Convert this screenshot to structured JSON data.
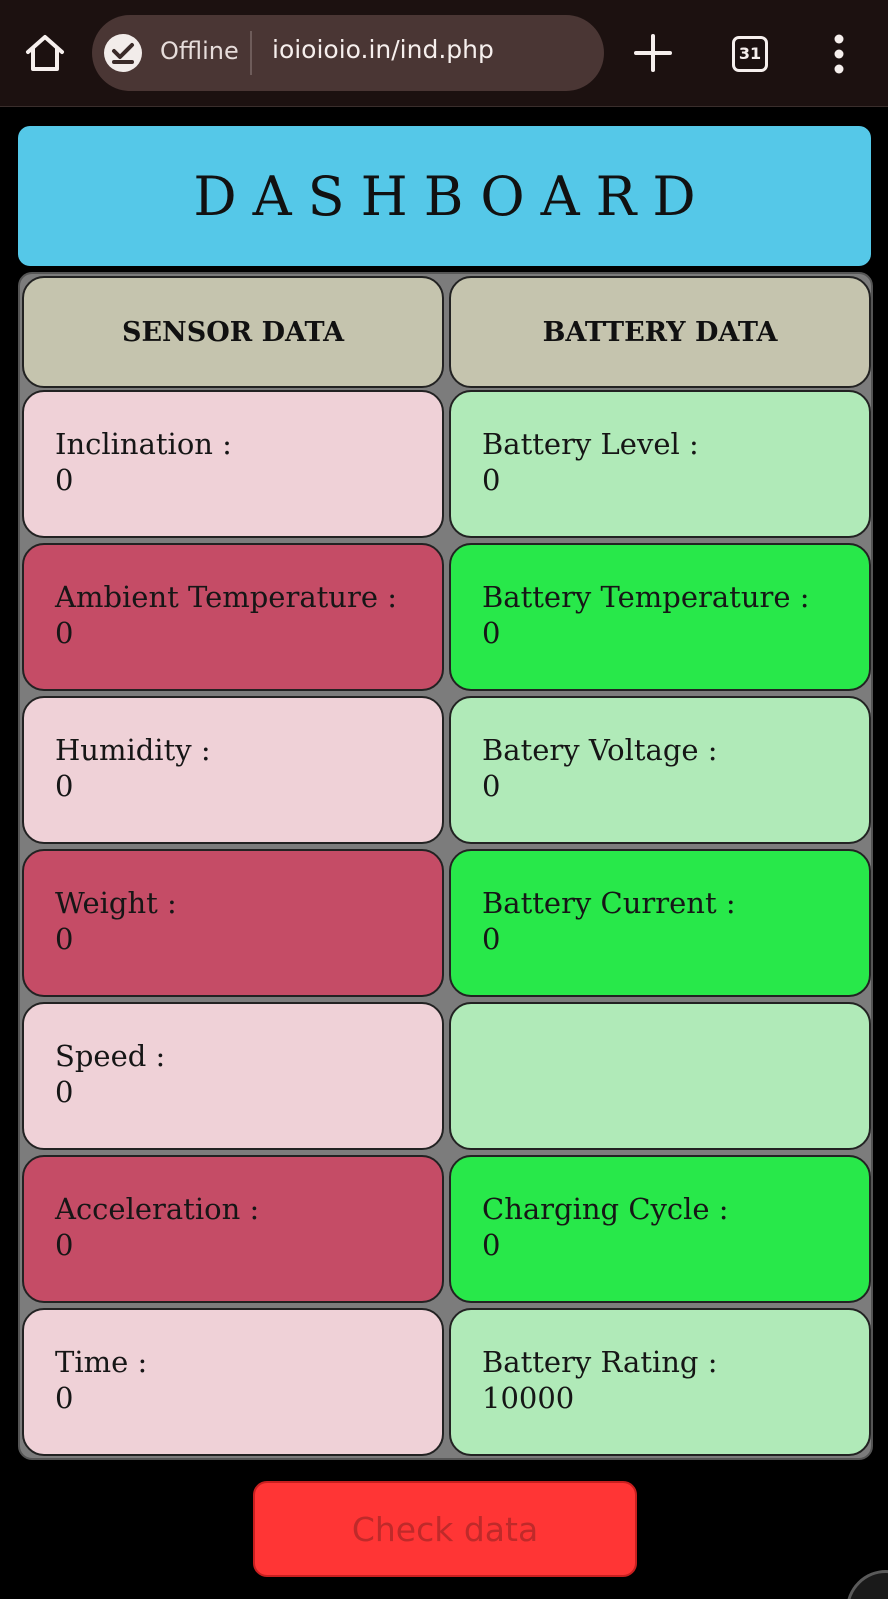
{
  "browser": {
    "status_text": "Offline",
    "url": "ioioioio.in/ind.php",
    "tab_count": "31",
    "icons": [
      "home-icon",
      "offline-check-icon",
      "plus-icon",
      "tabs-icon",
      "more-vert-icon"
    ]
  },
  "dashboard": {
    "title": "DASHBOARD",
    "sensor_header": "SENSOR DATA",
    "battery_header": "BATTERY DATA",
    "sensor_items": [
      {
        "label": "Inclination :",
        "value": "0"
      },
      {
        "label": "Ambient Temperature :",
        "value": "0"
      },
      {
        "label": "Humidity :",
        "value": "0"
      },
      {
        "label": "Weight :",
        "value": "0"
      },
      {
        "label": "Speed :",
        "value": "0"
      },
      {
        "label": "Acceleration :",
        "value": "0"
      },
      {
        "label": "Time :",
        "value": "0"
      }
    ],
    "battery_items": [
      {
        "label": "Battery Level :",
        "value": "0"
      },
      {
        "label": "Battery Temperature :",
        "value": "0"
      },
      {
        "label": "Batery Voltage :",
        "value": "0"
      },
      {
        "label": "Battery Current :",
        "value": "0"
      },
      {
        "label": "",
        "value": ""
      },
      {
        "label": "Charging Cycle :",
        "value": "0"
      },
      {
        "label": "Battery Rating :",
        "value": "10000"
      }
    ],
    "check_button": "Check data"
  },
  "colors": {
    "header_bg": "#55c8e8",
    "column_header_bg": "#c5c4ae",
    "sensor_light": "#efd1d7",
    "sensor_dark": "#c54c66",
    "battery_light": "#b0eab8",
    "battery_bright": "#28e84a",
    "check_button_bg": "#ff3535"
  }
}
